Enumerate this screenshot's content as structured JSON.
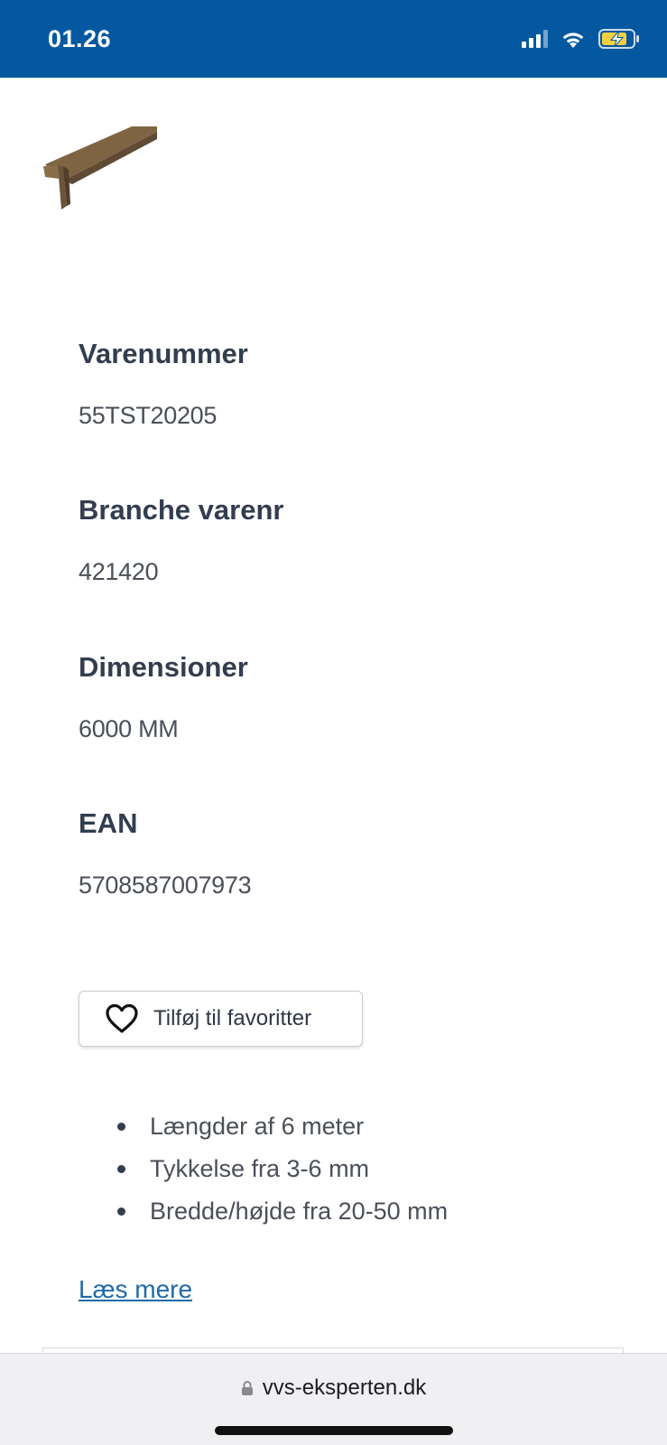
{
  "status_bar": {
    "time": "01.26",
    "icons": [
      "signal-icon",
      "wifi-icon",
      "battery-charging-icon"
    ],
    "background": "#0358a0"
  },
  "product": {
    "image_icon": "t-profile-product-image",
    "specs": [
      {
        "label": "Varenummer",
        "value": "55TST20205"
      },
      {
        "label": "Branche varenr",
        "value": "421420"
      },
      {
        "label": "Dimensioner",
        "value": "6000 MM"
      },
      {
        "label": "EAN",
        "value": "5708587007973"
      }
    ],
    "favorite_button": {
      "label": "Tilføj til favoritter",
      "icon": "heart-icon"
    },
    "features": [
      "Længder af 6 meter",
      "Tykkelse fra 3-6 mm",
      "Bredde/højde fra 20-50 mm"
    ],
    "read_more": "Læs mere"
  },
  "browser": {
    "url": "vvs-eksperten.dk",
    "icon": "lock-icon"
  }
}
